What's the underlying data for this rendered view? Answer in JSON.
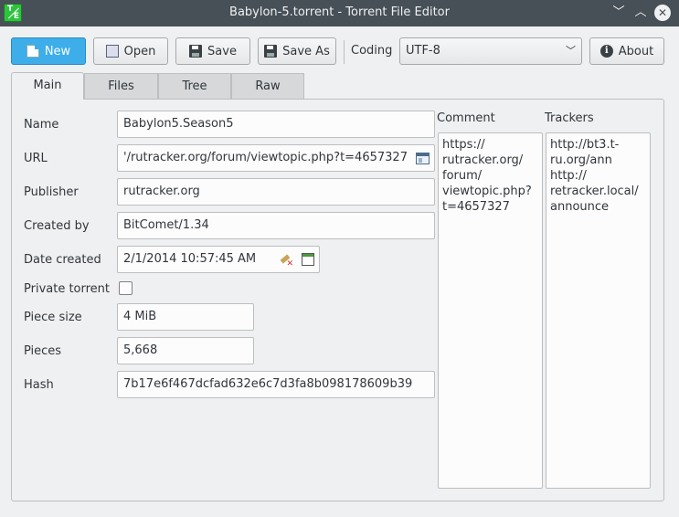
{
  "window": {
    "title": "Babylon-5.torrent - Torrent File Editor",
    "icon_letters": [
      "T",
      "E"
    ]
  },
  "toolbar": {
    "new_label": "New",
    "open_label": "Open",
    "save_label": "Save",
    "save_as_label": "Save As",
    "coding_label": "Coding",
    "coding_value": "UTF-8",
    "about_label": "About"
  },
  "tabs": [
    "Main",
    "Files",
    "Tree",
    "Raw"
  ],
  "active_tab": "Main",
  "form": {
    "name_label": "Name",
    "name_value": "Babylon5.Season5",
    "url_label": "URL",
    "url_value": "'/rutracker.org/forum/viewtopic.php?t=4657327",
    "publisher_label": "Publisher",
    "publisher_value": "rutracker.org",
    "created_by_label": "Created by",
    "created_by_value": "BitComet/1.34",
    "date_created_label": "Date created",
    "date_created_value": "2/1/2014 10:57:45 AM",
    "private_label": "Private torrent",
    "private_checked": false,
    "piece_size_label": "Piece size",
    "piece_size_value": "4 MiB",
    "pieces_label": "Pieces",
    "pieces_value": "5,668",
    "hash_label": "Hash",
    "hash_value": "7b17e6f467dcfad632e6c7d3fa8b098178609b39"
  },
  "comment": {
    "label": "Comment",
    "text": "https://\nrutracker.org/\nforum/\nviewtopic.php?\nt=4657327"
  },
  "trackers": {
    "label": "Trackers",
    "text": "http://bt3.t-\nru.org/ann\nhttp://\nretracker.local/\nannounce"
  },
  "colors": {
    "titlebar": "#475057",
    "accent": "#3daee9",
    "window_bg": "#eff0f1",
    "app_icon": "#2ec33e"
  }
}
